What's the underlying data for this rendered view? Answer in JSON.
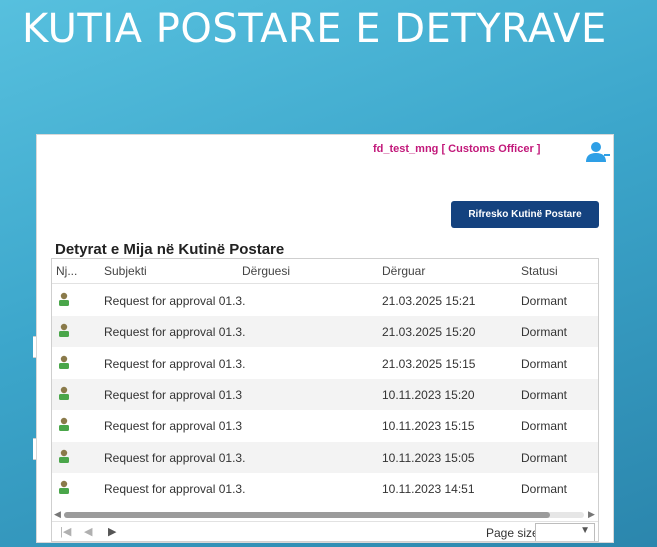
{
  "slide": {
    "title": "KUTIA POSTARE E DETYRAVE"
  },
  "header": {
    "user_line": "fd_test_mng [ Customs Officer ]",
    "avatar_icon": "user-icon"
  },
  "toolbar": {
    "refresh_label": "Rifresko Kutinë Postare"
  },
  "grid": {
    "title": "Detyrat e Mija në Kutinë Postare",
    "columns": [
      "Nj...",
      "Subjekti",
      "Dërguesi",
      "Dërguar",
      "Statusi"
    ],
    "rows": [
      {
        "icon": "task-user-icon",
        "subject": "Request for approval 01.3.",
        "sender": "",
        "sent": "21.03.2025 15:21",
        "status": "Dormant"
      },
      {
        "icon": "task-user-icon",
        "subject": "Request for approval 01.3.",
        "sender": "",
        "sent": "21.03.2025 15:20",
        "status": "Dormant"
      },
      {
        "icon": "task-user-icon",
        "subject": "Request for approval 01.3.",
        "sender": "",
        "sent": "21.03.2025 15:15",
        "status": "Dormant"
      },
      {
        "icon": "task-user-icon",
        "subject": "Request for approval 01.3",
        "sender": "",
        "sent": "10.11.2023 15:20",
        "status": "Dormant"
      },
      {
        "icon": "task-user-icon",
        "subject": "Request for approval 01.3",
        "sender": "",
        "sent": "10.11.2023 15:15",
        "status": "Dormant"
      },
      {
        "icon": "task-user-icon",
        "subject": "Request for approval 01.3.",
        "sender": "",
        "sent": "10.11.2023 15:05",
        "status": "Dormant"
      },
      {
        "icon": "task-user-icon",
        "subject": "Request for approval 01.3.",
        "sender": "",
        "sent": "10.11.2023 14:51",
        "status": "Dormant"
      }
    ]
  },
  "pager": {
    "page_size_label": "Page size",
    "page_size_value": ""
  },
  "colors": {
    "accent": "#14427f",
    "user_line": "#c2187a",
    "background": "#3ca6cb"
  }
}
